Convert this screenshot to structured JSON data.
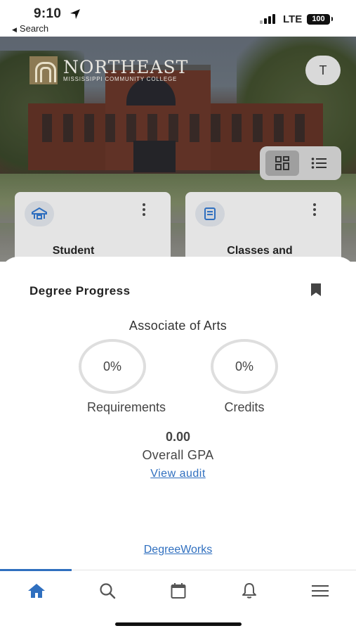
{
  "status_bar": {
    "time": "9:10",
    "back_label": "Search",
    "network": "LTE",
    "battery": "100"
  },
  "header": {
    "logo_name": "NORTHEAST",
    "logo_subtitle": "MISSISSIPPI COMMUNITY COLLEGE",
    "avatar_initial": "T"
  },
  "cards": [
    {
      "title": "Student",
      "icon": "school-icon"
    },
    {
      "title": "Classes and",
      "icon": "book-icon"
    }
  ],
  "degree_progress": {
    "title": "Degree Progress",
    "program": "Associate of Arts",
    "requirements_percent": "0%",
    "requirements_label": "Requirements",
    "credits_percent": "0%",
    "credits_label": "Credits",
    "gpa_value": "0.00",
    "gpa_label": "Overall GPA",
    "view_audit_label": "View audit",
    "degreeworks_label": "DegreeWorks"
  },
  "tab_bar": {
    "tabs": [
      {
        "name": "home",
        "icon": "home-icon",
        "active": true
      },
      {
        "name": "search",
        "icon": "search-icon",
        "active": false
      },
      {
        "name": "calendar",
        "icon": "calendar-icon",
        "active": false
      },
      {
        "name": "notifications",
        "icon": "bell-icon",
        "active": false
      },
      {
        "name": "menu",
        "icon": "menu-icon",
        "active": false
      }
    ]
  },
  "colors": {
    "accent": "#2f6fbf",
    "link": "#2f6fbf",
    "ring": "#dedede"
  }
}
